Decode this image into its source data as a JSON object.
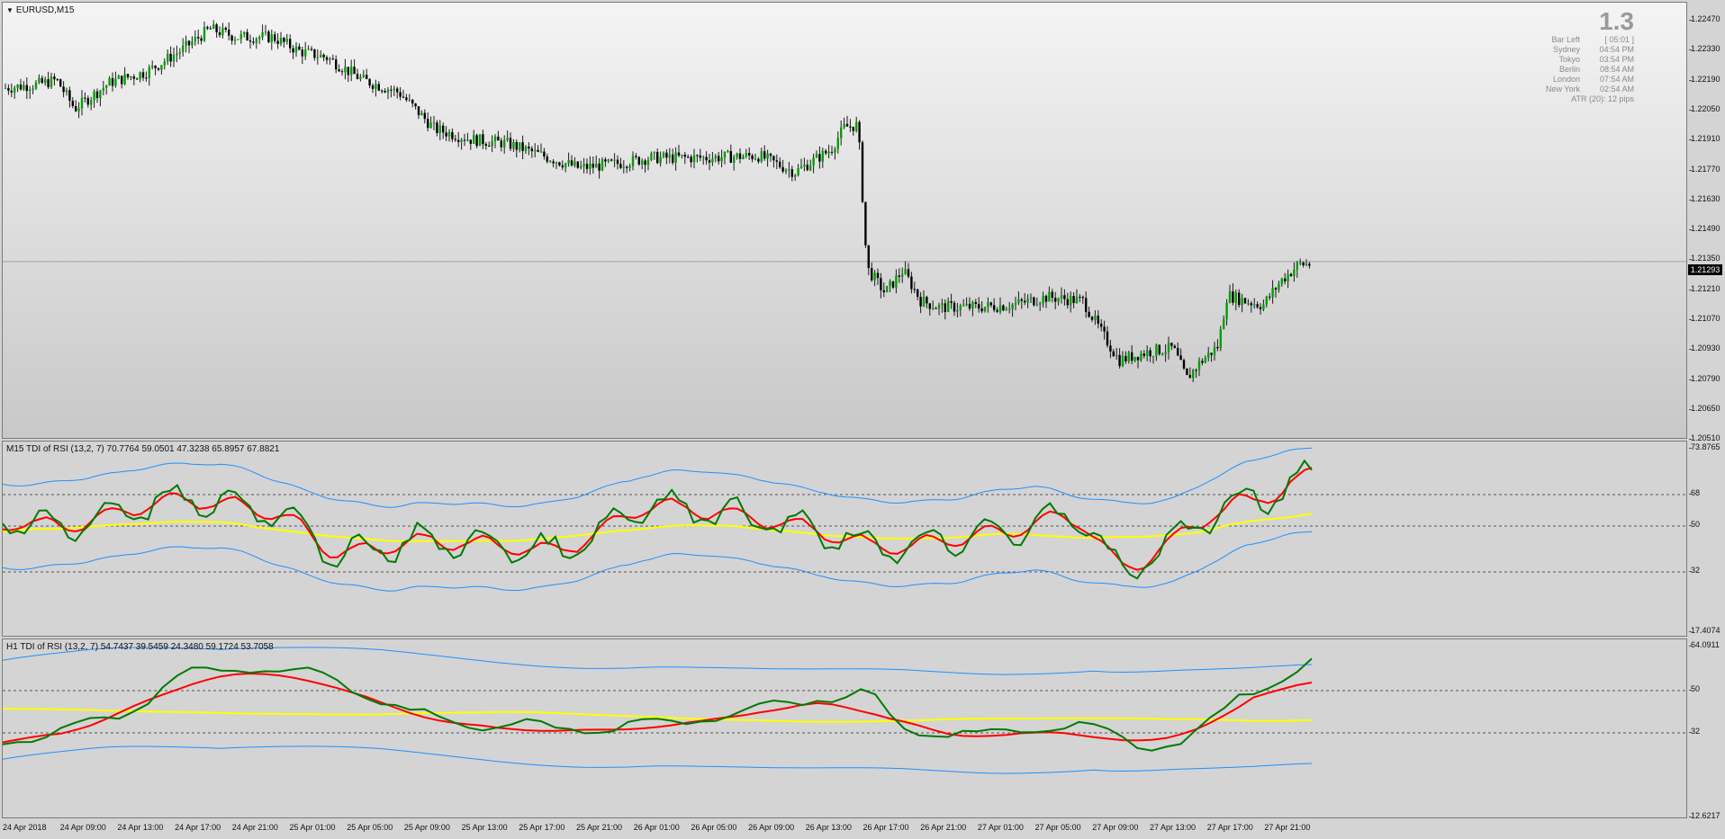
{
  "main": {
    "symbol": "EURUSD,M15",
    "current_price": "1.21293",
    "colors": {
      "bull": "#00a000",
      "bear": "#000000",
      "wick": "#1a1a1a",
      "price_line": "#a0a0a0"
    },
    "info": {
      "big_number": "1.3",
      "rows": [
        {
          "k": "Bar Left",
          "v": "[ 05:01 ]"
        },
        {
          "k": "Sydney",
          "v": "04:54 PM"
        },
        {
          "k": "Tokyo",
          "v": "03:54 PM"
        },
        {
          "k": "Berlin",
          "v": "08:54 AM"
        },
        {
          "k": "London",
          "v": "07:54 AM"
        },
        {
          "k": "New York",
          "v": "02:54 AM"
        }
      ],
      "atr": "ATR (20): 12 pips"
    },
    "price_axis": [
      "1.22470",
      "1.22330",
      "1.22190",
      "1.22050",
      "1.21910",
      "1.21770",
      "1.21630",
      "1.21490",
      "1.21350",
      "1.21210",
      "1.21070",
      "1.20930",
      "1.20790",
      "1.20650",
      "1.20510"
    ]
  },
  "m15_tdi": {
    "title": "M15 TDI of RSI  (13,2, 7) 70.7764 59.0501 47.3238 65.8957 67.8821",
    "axis": [
      "73.8765",
      "68",
      "50",
      "32",
      "17.4074"
    ],
    "colors": {
      "rsi": "#007a00",
      "signal": "#ff0000",
      "base": "#ffff00",
      "bands": "#1e90ff"
    }
  },
  "h1_tdi": {
    "title": "H1 TDI of RSI  (13,2, 7) 54.7437 39.5459 24.3480 59.1724 53.7058",
    "axis": [
      "64.0911",
      "50",
      "32",
      "12.6217"
    ]
  },
  "time_axis": [
    "24 Apr 2018",
    "24 Apr 09:00",
    "24 Apr 13:00",
    "24 Apr 17:00",
    "24 Apr 21:00",
    "25 Apr 01:00",
    "25 Apr 05:00",
    "25 Apr 09:00",
    "25 Apr 13:00",
    "25 Apr 17:00",
    "25 Apr 21:00",
    "26 Apr 01:00",
    "26 Apr 05:00",
    "26 Apr 09:00",
    "26 Apr 13:00",
    "26 Apr 17:00",
    "26 Apr 21:00",
    "27 Apr 01:00",
    "27 Apr 05:00",
    "27 Apr 09:00",
    "27 Apr 13:00",
    "27 Apr 17:00",
    "27 Apr 21:00"
  ]
}
